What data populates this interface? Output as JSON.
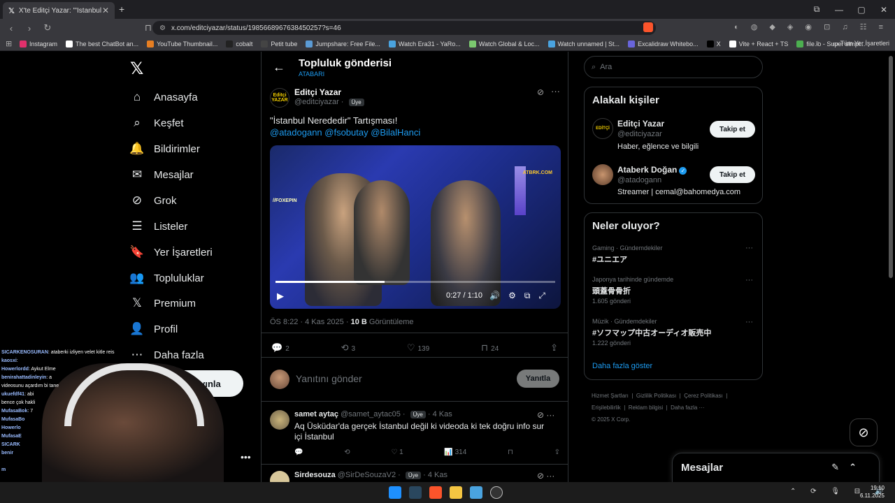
{
  "browser": {
    "tab_title": "X'te Editçi Yazar: \"'İstanbul Nere",
    "url": "x.com/editciyazar/status/1985668967638450257?s=46",
    "bookmarks": [
      {
        "label": "Instagram",
        "color": "#e1306c"
      },
      {
        "label": "The best ChatBot an...",
        "color": "#ffffff"
      },
      {
        "label": "YouTube Thumbnail...",
        "color": "#e67e22"
      },
      {
        "label": "cobalt",
        "color": "#222222"
      },
      {
        "label": "Petit tube",
        "color": "#444444"
      },
      {
        "label": "Jumpshare: Free File...",
        "color": "#5b9bd5"
      },
      {
        "label": "Watch Era31 - YaRo...",
        "color": "#4aa3df"
      },
      {
        "label": "Watch Global & Loc...",
        "color": "#7bc96f"
      },
      {
        "label": "Watch unnamed | St...",
        "color": "#4aa3df"
      },
      {
        "label": "Excalidraw Whitebo...",
        "color": "#6965db"
      },
      {
        "label": "X",
        "color": "#000000"
      },
      {
        "label": "Vite + React + TS",
        "color": "#ffffff"
      },
      {
        "label": "file.io - Super simpl...",
        "color": "#4caf50"
      }
    ],
    "all_bookmarks": "Tüm Yer İşaretleri"
  },
  "sidebar": {
    "items": [
      {
        "label": "Anasayfa",
        "icon": "⌂"
      },
      {
        "label": "Keşfet",
        "icon": "⌕"
      },
      {
        "label": "Bildirimler",
        "icon": "🔔"
      },
      {
        "label": "Mesajlar",
        "icon": "✉"
      },
      {
        "label": "Grok",
        "icon": "⊘"
      },
      {
        "label": "Listeler",
        "icon": "☰"
      },
      {
        "label": "Yer İşaretleri",
        "icon": "🔖"
      },
      {
        "label": "Topluluklar",
        "icon": "👥"
      },
      {
        "label": "Premium",
        "icon": "𝕏"
      },
      {
        "label": "Profil",
        "icon": "👤"
      },
      {
        "label": "Daha fazla",
        "icon": "⋯"
      }
    ],
    "post_button": "Gönderi yayınla"
  },
  "chat": [
    {
      "user": "SICARKENOSURAN",
      "text": ": ataberki izliyen velet kitle reis"
    },
    {
      "user": "kaosxi",
      "text": ":"
    },
    {
      "user": "Howerlordd",
      "text": ": Aykut Elme"
    },
    {
      "user": "benirahattadinleyin",
      "text": ": a"
    },
    {
      "user": "",
      "text": "videosunu açardım bi tane"
    },
    {
      "user": "ukuefdf41",
      "text": ": abi"
    },
    {
      "user": "",
      "text": "bence çok hakli"
    },
    {
      "user": "MufasaBok",
      "text": ": 7"
    },
    {
      "user": "MufasaBo",
      "text": ""
    },
    {
      "user": "Howerlo",
      "text": ""
    },
    {
      "user": "MufasaE",
      "text": ""
    },
    {
      "user": "SICARK",
      "text": ""
    },
    {
      "user": "benir",
      "text": ""
    },
    {
      "user": "",
      "text": ""
    },
    {
      "user": "m",
      "text": ""
    },
    {
      "user": "",
      "text": ""
    }
  ],
  "post_header": {
    "title": "Topluluk gönderisi",
    "subtitle": "ATABARI"
  },
  "post": {
    "author_name": "Editçi Yazar",
    "author_handle": "@editciyazar",
    "badge": "Üye",
    "avatar_text": "Editçi YAZAR",
    "text": "\"İstanbul Nerededir\" Tartışması!",
    "mentions": "@atadogann @fsobutay @BilalHanci",
    "video": {
      "time": "0:27 / 1:10",
      "progress": 0.39,
      "watermark_left": "//FOXEPIN",
      "watermark_right": "ATBRK.COM"
    },
    "meta_time": "ÖS 8:22 · 4 Kas 2025 · ",
    "meta_views": "10 B",
    "meta_views_label": " Görüntüleme",
    "stats": {
      "replies": "2",
      "reposts": "3",
      "likes": "139",
      "bookmarks": "24"
    }
  },
  "reply": {
    "placeholder": "Yanıtını gönder",
    "button": "Yanıtla"
  },
  "comments": [
    {
      "name": "samet aytaç",
      "handle": "@samet_aytac05",
      "badge": "Üye",
      "time": "· 4 Kas",
      "text": "Aq Üsküdar'da gerçek  İstanbul değil ki videoda ki tek doğru info sur içi İstanbul",
      "likes": "1",
      "views": "314"
    },
    {
      "name": "Sirdesouza",
      "handle": "@SirDeSouzaV2",
      "badge": "Üye",
      "time": "· 4 Kas"
    }
  ],
  "search": {
    "placeholder": "Ara"
  },
  "related": {
    "title": "Alakalı kişiler",
    "people": [
      {
        "name": "Editçi Yazar",
        "handle": "@editciyazar",
        "bio": "Haber, eğlence ve bilgili",
        "follow": "Takip et",
        "verified": false
      },
      {
        "name": "Ataberk Doğan",
        "handle": "@atadogann",
        "bio": "Streamer | cemal@bahomedya.com",
        "follow": "Takip et",
        "verified": true
      }
    ]
  },
  "trends": {
    "title": "Neler oluyor?",
    "items": [
      {
        "meta": "Gaming · Gündemdekiler",
        "name": "#ユニエア",
        "count": ""
      },
      {
        "meta": "Japonya tarihinde gündemde",
        "name": "頭蓋骨骨折",
        "count": "1.605 gönderi"
      },
      {
        "meta": "Müzik · Gündemdekiler",
        "name": "#ソフマップ中古オーディオ販売中",
        "count": "1.222 gönderi"
      }
    ],
    "show_more": "Daha fazla göster"
  },
  "footer": {
    "links": [
      "Hizmet Şartları",
      "Gizlilik Politikası",
      "Çerez Politikası",
      "Erişilebilirlik",
      "Reklam bilgisi",
      "Daha fazla ···"
    ],
    "copyright": "© 2025 X Corp."
  },
  "messages_drawer": {
    "title": "Mesajlar"
  },
  "taskbar": {
    "time": "19:10",
    "date": "6.11.2025"
  }
}
